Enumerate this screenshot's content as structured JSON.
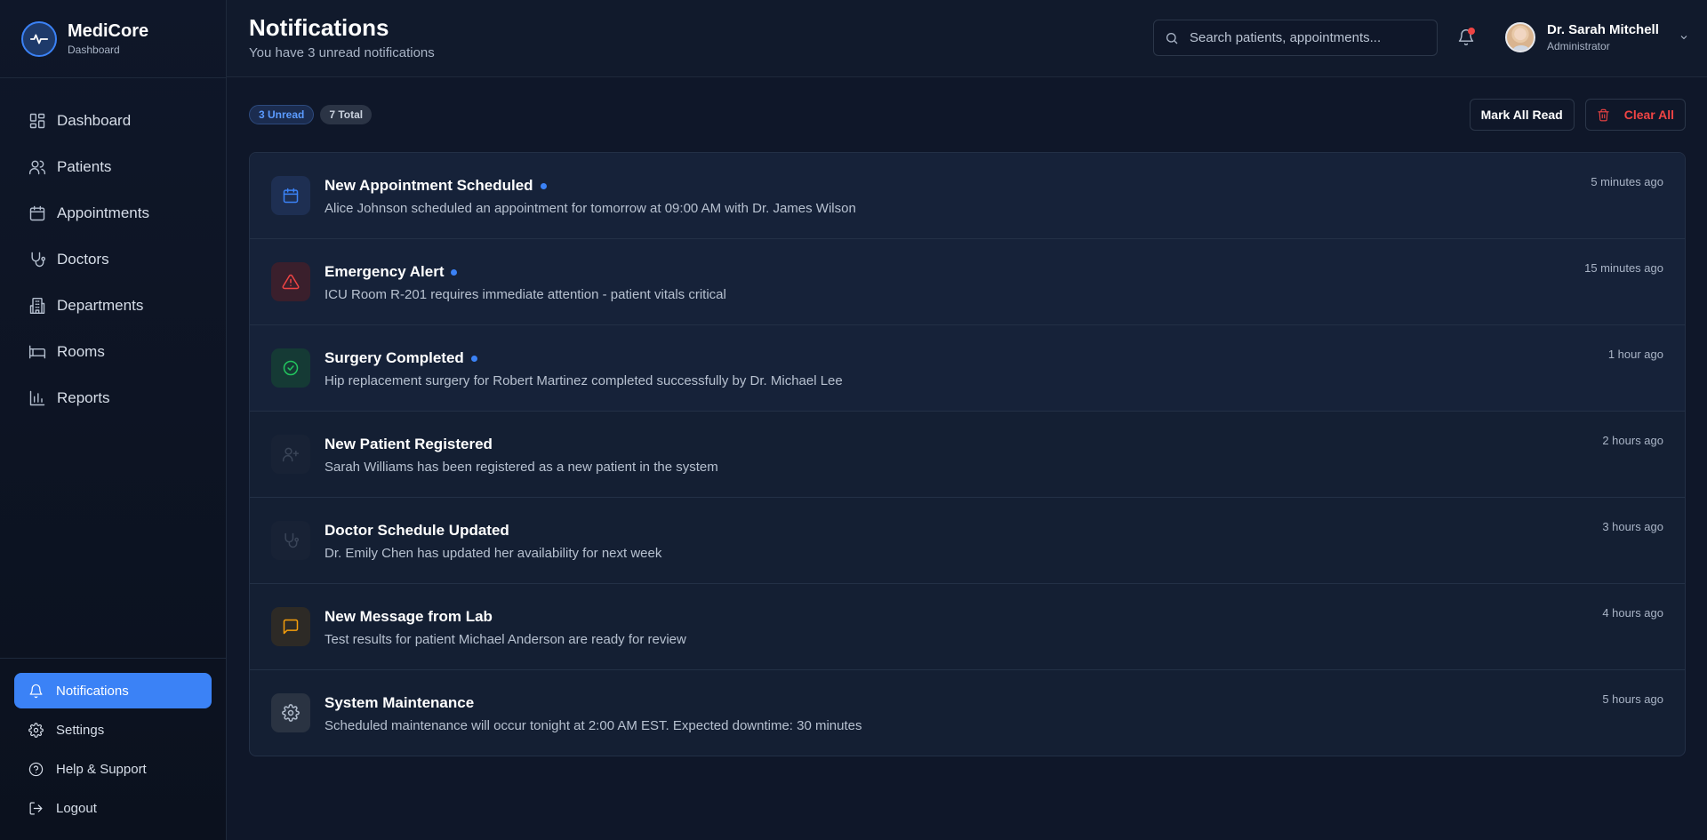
{
  "brand": {
    "name": "MediCore",
    "subtitle": "Dashboard"
  },
  "nav": [
    {
      "label": "Dashboard",
      "icon": "dashboard-icon"
    },
    {
      "label": "Patients",
      "icon": "users-icon"
    },
    {
      "label": "Appointments",
      "icon": "calendar-icon"
    },
    {
      "label": "Doctors",
      "icon": "stethoscope-icon"
    },
    {
      "label": "Departments",
      "icon": "building-icon"
    },
    {
      "label": "Rooms",
      "icon": "bed-icon"
    },
    {
      "label": "Reports",
      "icon": "bar-chart-icon"
    }
  ],
  "sidebar_bottom": [
    {
      "label": "Notifications",
      "icon": "bell-icon",
      "active": true
    },
    {
      "label": "Settings",
      "icon": "gear-icon"
    },
    {
      "label": "Help & Support",
      "icon": "help-circle-icon"
    },
    {
      "label": "Logout",
      "icon": "logout-icon"
    }
  ],
  "header": {
    "title": "Notifications",
    "subtitle": "You have 3 unread notifications",
    "search_placeholder": "Search patients, appointments..."
  },
  "user": {
    "name": "Dr. Sarah Mitchell",
    "role": "Administrator"
  },
  "badges": {
    "unread": "3 Unread",
    "total": "7 Total"
  },
  "actions": {
    "mark_all_read": "Mark All Read",
    "clear_all": "Clear All"
  },
  "colors": {
    "accent": "#3b82f6",
    "danger": "#ef4444",
    "success": "#22c55e",
    "warning": "#f59e0b",
    "background": "#0f1729"
  },
  "notifications": [
    {
      "title": "New Appointment Scheduled",
      "message": "Alice Johnson scheduled an appointment for tomorrow at 09:00 AM with Dr. James Wilson",
      "time": "5 minutes ago",
      "unread": true,
      "icon": "calendar-icon"
    },
    {
      "title": "Emergency Alert",
      "message": "ICU Room R-201 requires immediate attention - patient vitals critical",
      "time": "15 minutes ago",
      "unread": true,
      "icon": "alert-triangle-icon"
    },
    {
      "title": "Surgery Completed",
      "message": "Hip replacement surgery for Robert Martinez completed successfully by Dr. Michael Lee",
      "time": "1 hour ago",
      "unread": true,
      "icon": "check-circle-icon"
    },
    {
      "title": "New Patient Registered",
      "message": "Sarah Williams has been registered as a new patient in the system",
      "time": "2 hours ago",
      "unread": false,
      "icon": "user-plus-icon"
    },
    {
      "title": "Doctor Schedule Updated",
      "message": "Dr. Emily Chen has updated her availability for next week",
      "time": "3 hours ago",
      "unread": false,
      "icon": "stethoscope-icon"
    },
    {
      "title": "New Message from Lab",
      "message": "Test results for patient Michael Anderson are ready for review",
      "time": "4 hours ago",
      "unread": false,
      "icon": "message-square-icon"
    },
    {
      "title": "System Maintenance",
      "message": "Scheduled maintenance will occur tonight at 2:00 AM EST. Expected downtime: 30 minutes",
      "time": "5 hours ago",
      "unread": false,
      "icon": "gear-icon"
    }
  ]
}
